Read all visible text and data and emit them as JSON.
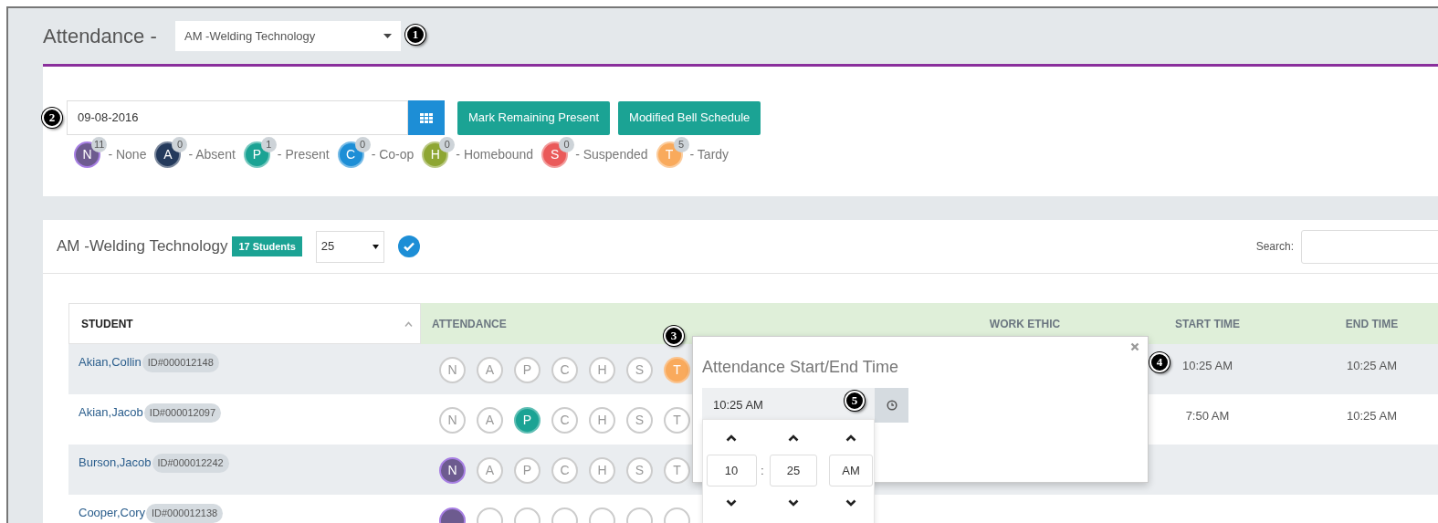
{
  "header": {
    "title": "Attendance -",
    "class_select": "AM -Welding Technology"
  },
  "date_field": {
    "value": "09-08-2016"
  },
  "buttons": [
    "Mark Remaining Present",
    "Modified Bell Schedule"
  ],
  "legend": [
    {
      "letter": "N",
      "count": "11",
      "label": "- None",
      "color": "#6d5b8f"
    },
    {
      "letter": "A",
      "count": "0",
      "label": "- Absent",
      "color": "#243a5c"
    },
    {
      "letter": "P",
      "count": "1",
      "label": "- Present",
      "color": "#1ba394"
    },
    {
      "letter": "C",
      "count": "0",
      "label": "- Co-op",
      "color": "#1d8ed6"
    },
    {
      "letter": "H",
      "count": "0",
      "label": "- Homebound",
      "color": "#8ea633"
    },
    {
      "letter": "S",
      "count": "0",
      "label": "- Suspended",
      "color": "#ea5a5a"
    },
    {
      "letter": "T",
      "count": "5",
      "label": "- Tardy",
      "color": "#f9aa5c"
    }
  ],
  "section": {
    "title": "AM -Welding Technology",
    "badge": "17 Students",
    "page_size": "25",
    "search_label": "Search:"
  },
  "table": {
    "columns": [
      "STUDENT",
      "ATTENDANCE",
      "WORK ETHIC",
      "START TIME",
      "END TIME"
    ],
    "rows": [
      {
        "name": "Akian,Collin",
        "id": "ID#000012148",
        "start_time": "10:25 AM",
        "end_time": "10:25 AM",
        "marks": [
          {
            "letter": "N",
            "selected": false
          },
          {
            "letter": "A",
            "selected": false
          },
          {
            "letter": "P",
            "selected": false
          },
          {
            "letter": "C",
            "selected": false
          },
          {
            "letter": "H",
            "selected": false
          },
          {
            "letter": "S",
            "selected": false
          },
          {
            "letter": "T",
            "selected": true
          }
        ]
      },
      {
        "name": "Akian,Jacob",
        "id": "ID#000012097",
        "start_time": "7:50 AM",
        "end_time": "10:25 AM",
        "marks": [
          {
            "letter": "N",
            "selected": false
          },
          {
            "letter": "A",
            "selected": false
          },
          {
            "letter": "P",
            "selected": true
          },
          {
            "letter": "C",
            "selected": false
          },
          {
            "letter": "H",
            "selected": false
          },
          {
            "letter": "S",
            "selected": false
          },
          {
            "letter": "T",
            "selected": false
          }
        ]
      },
      {
        "name": "Burson,Jacob",
        "id": "ID#000012242",
        "marks": [
          {
            "letter": "N",
            "selected": true
          },
          {
            "letter": "A",
            "selected": false
          },
          {
            "letter": "P",
            "selected": false
          },
          {
            "letter": "C",
            "selected": false
          },
          {
            "letter": "H",
            "selected": false
          },
          {
            "letter": "S",
            "selected": false
          },
          {
            "letter": "T",
            "selected": false
          }
        ]
      },
      {
        "name": "Cooper,Cory",
        "id": "ID#000012138",
        "marks": [
          {
            "selected": true
          },
          {
            "selected": false
          },
          {
            "selected": false
          },
          {
            "selected": false
          },
          {
            "selected": false
          },
          {
            "selected": false
          },
          {
            "selected": false
          }
        ]
      }
    ]
  },
  "popover": {
    "title": "Attendance Start/End Time",
    "value": "10:25 AM",
    "hour": "10",
    "separator": ":",
    "minute": "25",
    "period": "AM"
  },
  "callouts": [
    "1",
    "2",
    "3",
    "4",
    "5"
  ]
}
